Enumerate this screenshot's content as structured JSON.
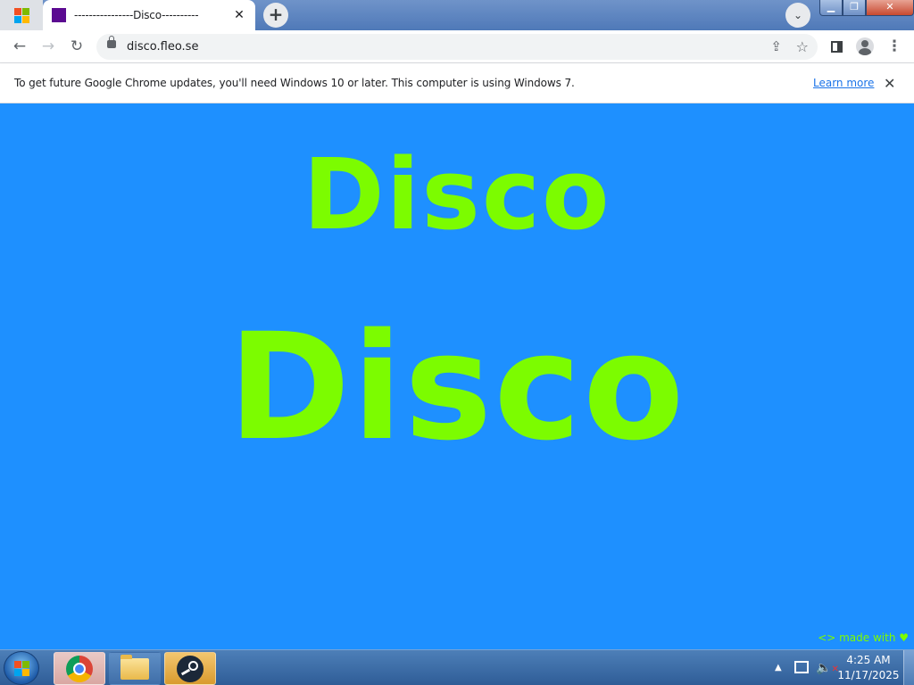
{
  "browser": {
    "tab": {
      "title": "----------------Disco----------",
      "close_glyph": "✕"
    },
    "new_tab_glyph": "+",
    "tab_search_glyph": "⌄",
    "window_controls": {
      "minimize": "▁",
      "maximize": "❐",
      "close": "✕"
    },
    "toolbar": {
      "back": "←",
      "forward": "→",
      "reload": "↻",
      "menu": "⋮",
      "share": "⇪",
      "bookmark": "☆"
    },
    "omnibox": {
      "url": "disco.fleo.se"
    },
    "infobar": {
      "message": "To get future Google Chrome updates, you'll need Windows 10 or later. This computer is using Windows 7.",
      "link": "Learn more",
      "close_glyph": "✕"
    }
  },
  "page": {
    "heading_small": "Disco",
    "heading_big": "Disco",
    "footer": "<> made with ♥",
    "colors": {
      "background": "#1e90ff",
      "text": "#7cfc00"
    }
  },
  "taskbar": {
    "apps": [
      "Google Chrome",
      "Windows Explorer",
      "Steam"
    ],
    "tray_arrow": "▲",
    "volume_glyph": "🔈",
    "mute_glyph": "✕",
    "clock": {
      "time": "4:25 AM",
      "date": "11/17/2025"
    }
  }
}
